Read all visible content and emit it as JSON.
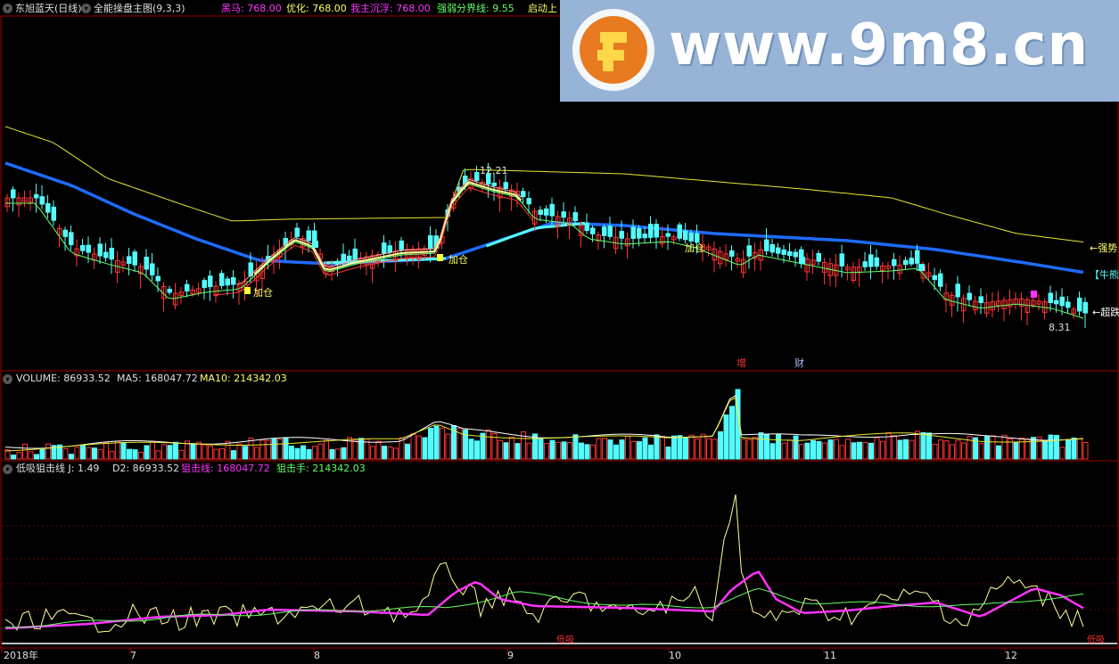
{
  "main_panel": {
    "stock_name": "东旭蓝天(日线)",
    "indicator_name": "全能操盘主图(9,3,3)",
    "readouts": [
      {
        "label": "黑马:",
        "value": "768.00",
        "color": "#ff33ff"
      },
      {
        "label": "优化:",
        "value": "768.00",
        "color": "#ffff66"
      },
      {
        "label": "我主沉浮:",
        "value": "768.00",
        "color": "#ff33ff"
      },
      {
        "label": "强弱分界线:",
        "value": "9.55",
        "color": "#66ff66"
      },
      {
        "label": "启动上",
        "value": "",
        "color": "#ffff66"
      }
    ],
    "price_high_label": "12.21",
    "price_low_label": "8.31",
    "annotations": {
      "jiacang_1": "加仓",
      "jiacang_2": "加仓",
      "jiacang_3": "加仓",
      "qiangshi": "←强势",
      "niuxiong": "【牛熊",
      "chaodie": "←超跌",
      "zeng": "增",
      "cai": "财"
    }
  },
  "volume_panel": {
    "title": "VOLUME: 86933.52",
    "ma5": "MA5: 168047.72",
    "ma10": "MA10: 214342.03"
  },
  "indicator_panel": {
    "title": "低吸狙击线  J: 1.49",
    "d2": "D2: 86933.52",
    "jujixian": "狙击线: 168047.72",
    "jujishou": "狙击手: 214342.03",
    "bottom_mark_1": "低吸",
    "bottom_mark_2": "低吸"
  },
  "time_axis": {
    "labels": [
      "2018年",
      "7",
      "8",
      "9",
      "10",
      "11",
      "12"
    ]
  },
  "watermark": {
    "text": "www.9m8.cn",
    "logo_text": "www.9m8.cn"
  },
  "colors": {
    "background": "#000000",
    "frame": "#a00000",
    "up_candle": "#ff3232",
    "down_candle": "#54fcfc",
    "ma_blue": "#1e6bff",
    "ma_yellow": "#e8e830",
    "magenta": "#ff33ff"
  }
}
